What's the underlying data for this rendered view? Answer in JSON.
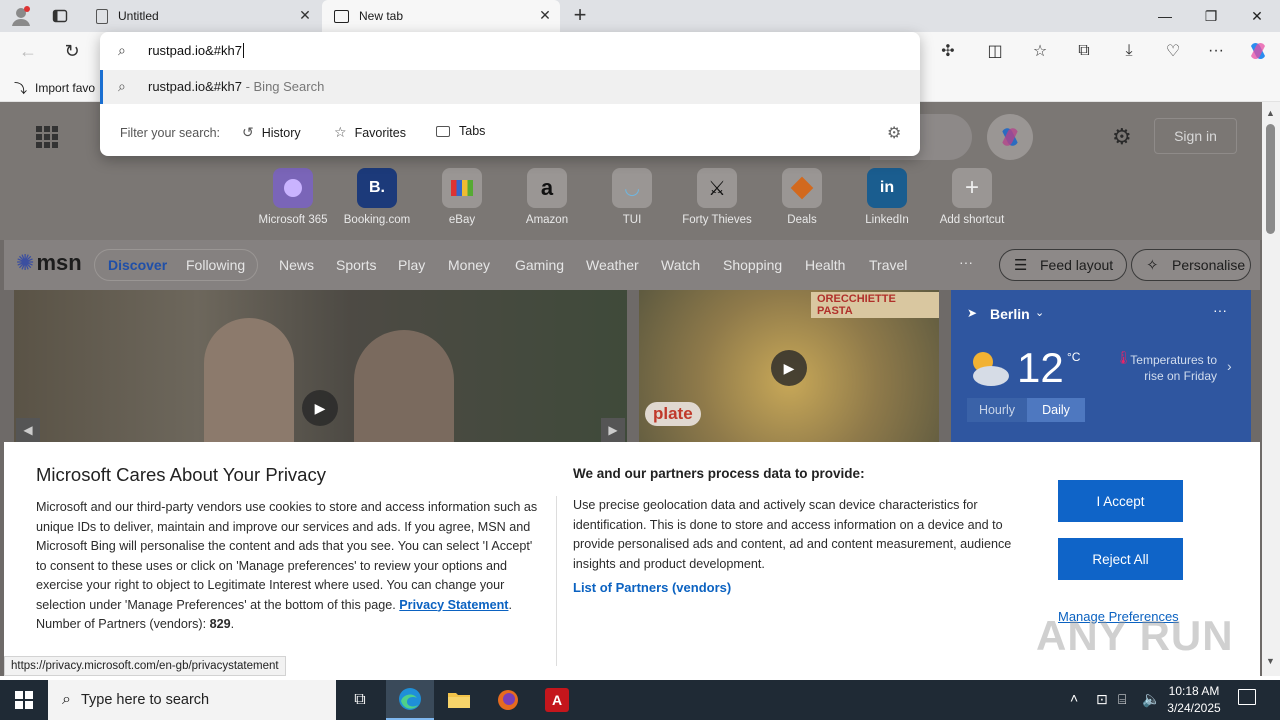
{
  "browser": {
    "tabs": [
      {
        "title": "Untitled",
        "icon": "page-icon"
      },
      {
        "title": "New tab",
        "icon": "newtab-icon"
      }
    ],
    "favorites_bar": {
      "import_label": "Import favo"
    }
  },
  "omnibox": {
    "typed_text": "rustpad.io&#kh7",
    "suggestion": {
      "text": "rustpad.io&#kh7",
      "suffix": " - Bing Search"
    },
    "filter_label": "Filter your search:",
    "filters": [
      "History",
      "Favorites",
      "Tabs"
    ]
  },
  "newtab": {
    "sign_in": "Sign in",
    "shortcuts": [
      {
        "label": "Microsoft 365",
        "glyph": ""
      },
      {
        "label": "Booking.com",
        "glyph": "B."
      },
      {
        "label": "eBay",
        "glyph": ""
      },
      {
        "label": "Amazon",
        "glyph": "a"
      },
      {
        "label": "TUI",
        "glyph": ""
      },
      {
        "label": "Forty Thieves",
        "glyph": ""
      },
      {
        "label": "Deals",
        "glyph": ""
      },
      {
        "label": "LinkedIn",
        "glyph": "in"
      },
      {
        "label": "Add shortcut",
        "glyph": "+"
      }
    ],
    "msn_logo": "msn",
    "nav": [
      "Discover",
      "Following",
      "News",
      "Sports",
      "Play",
      "Money",
      "Gaming",
      "Weather",
      "Watch",
      "Shopping",
      "Health",
      "Travel"
    ],
    "more": "···",
    "feed_layout": "Feed layout",
    "personalise": "Personalise",
    "card2_banner": "ORECCHIETTE PASTA",
    "card2_logo": "plate",
    "weather": {
      "city": "Berlin",
      "temp": "12",
      "unit": "°C",
      "note": "Temperatures to rise on Friday",
      "tab_hourly": "Hourly",
      "tab_daily": "Daily"
    }
  },
  "privacy": {
    "title": "Microsoft Cares About Your Privacy",
    "body": "Microsoft and our third-party vendors use cookies to store and access information such as unique IDs to deliver, maintain and improve our services and ads. If you agree, MSN and Microsoft Bing will personalise the content and ads that you see. You can select 'I Accept' to consent to these uses or click on 'Manage preferences' to review your options and exercise your right to object to Legitimate Interest where used.  You can change your selection under 'Manage Preferences' at the bottom of this page. ",
    "privacy_link": "Privacy Statement",
    "partners_label": "Number of Partners (vendors): ",
    "partners_count": "829",
    "right_title": "We and our partners process data to provide:",
    "right_body": "Use precise geolocation data and actively scan device characteristics for identification. This is done to store and access information on a device and to provide personalised ads and content, ad and content measurement, audience insights and product development.",
    "partners_link": "List of Partners (vendors)",
    "accept": "I Accept",
    "reject": "Reject All",
    "manage": "Manage Preferences"
  },
  "status_url": "https://privacy.microsoft.com/en-gb/privacystatement",
  "taskbar": {
    "search_placeholder": "Type here to search",
    "time": "10:18 AM",
    "date": "3/24/2025"
  },
  "watermark": "ANY RUN"
}
